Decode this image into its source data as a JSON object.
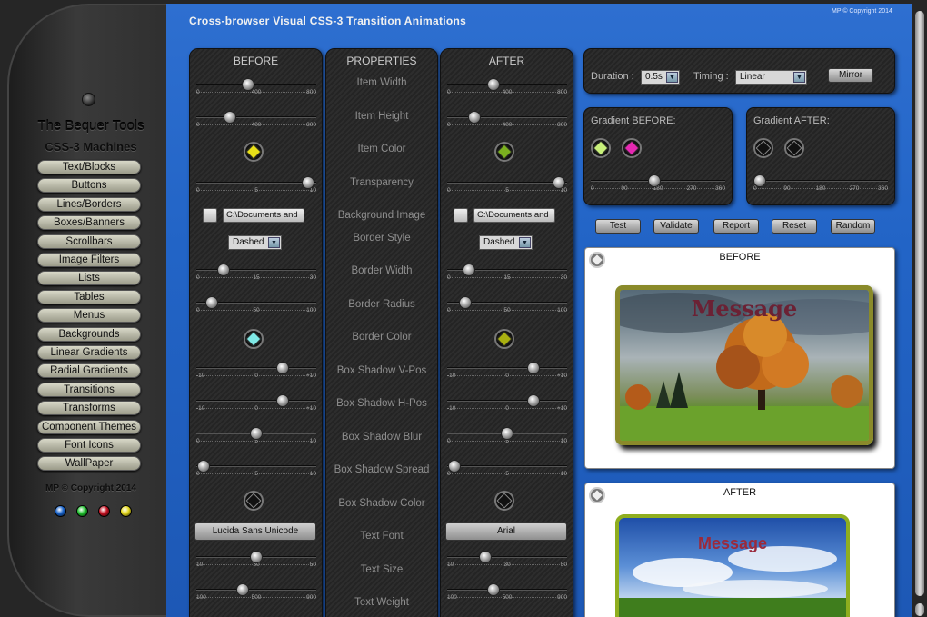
{
  "app": {
    "title": "Cross-browser Visual CSS-3 Transition Animations",
    "copyright": "MP © Copyright 2014"
  },
  "sidebar": {
    "title": "The Bequer Tools",
    "subtitle": "CSS-3 Machines",
    "items": [
      "Text/Blocks",
      "Buttons",
      "Lines/Borders",
      "Boxes/Banners",
      "Scrollbars",
      "Image Filters",
      "Lists",
      "Tables",
      "Menus",
      "Backgrounds",
      "Linear Gradients",
      "Radial Gradients",
      "Transitions",
      "Transforms",
      "Component Themes",
      "Font Icons",
      "WallPaper"
    ],
    "copyright": "MP © Copyright 2014",
    "dots": [
      "#1560c8",
      "#1bbf2a",
      "#c41020",
      "#e3d61a"
    ]
  },
  "columns": {
    "before": "BEFORE",
    "properties": "PROPERTIES",
    "after": "AFTER"
  },
  "properties": [
    "Item Width",
    "Item Height",
    "Item Color",
    "Transparency",
    "Background Image",
    "Border Style",
    "Border Width",
    "Border Radius",
    "Border Color",
    "Box Shadow V-Pos",
    "Box Shadow H-Pos",
    "Box Shadow Blur",
    "Box Shadow Spread",
    "Box Shadow Color",
    "Text Font",
    "Text Size",
    "Text Weight"
  ],
  "scales": {
    "width": [
      "0",
      "400",
      "800"
    ],
    "height": [
      "0",
      "400",
      "800"
    ],
    "transparency": [
      "0",
      "5",
      "10"
    ],
    "border_width": [
      "0",
      "15",
      "30"
    ],
    "border_radius": [
      "0",
      "50",
      "100"
    ],
    "shadow_v": [
      "-10",
      "0",
      "+10"
    ],
    "shadow_h": [
      "-10",
      "0",
      "+10"
    ],
    "shadow_blur": [
      "0",
      "5",
      "10"
    ],
    "shadow_spread": [
      "0",
      "5",
      "10"
    ],
    "text_size": [
      "10",
      "30",
      "50"
    ],
    "text_weight": [
      "100",
      "500",
      "900"
    ]
  },
  "before": {
    "width_value": 0.43,
    "height_value": 0.28,
    "item_color": "#e8e018",
    "transparency_value": 0.93,
    "bg_image_path": "C:\\Documents and",
    "border_style": "Dashed",
    "border_width_value": 0.23,
    "border_radius_value": 0.13,
    "border_color": "#7fe9e6",
    "shadow_v_value": 0.72,
    "shadow_h_value": 0.72,
    "shadow_blur_value": 0.5,
    "shadow_spread_value": 0.06,
    "shadow_color": "#111111",
    "text_font": "Lucida Sans Unicode",
    "text_size_value": 0.5,
    "text_weight_value": 0.39
  },
  "after": {
    "width_value": 0.39,
    "height_value": 0.23,
    "item_color": "#7bb01f",
    "transparency_value": 0.93,
    "bg_image_path": "C:\\Documents and",
    "border_style": "Dashed",
    "border_width_value": 0.18,
    "border_radius_value": 0.15,
    "border_color": "#a9b010",
    "shadow_v_value": 0.72,
    "shadow_h_value": 0.72,
    "shadow_blur_value": 0.5,
    "shadow_spread_value": 0.06,
    "shadow_color": "#111111",
    "text_font": "Arial",
    "text_size_value": 0.32,
    "text_weight_value": 0.39
  },
  "settings": {
    "duration_label": "Duration :",
    "duration_value": "0.5s",
    "timing_label": "Timing :",
    "timing_value": "Linear",
    "mirror_label": "Mirror"
  },
  "gradient_before": {
    "label": "Gradient BEFORE:",
    "colors": [
      "#c8f07a",
      "#e628b2"
    ],
    "scale": [
      "0",
      "90",
      "180",
      "270",
      "360"
    ],
    "value": 0.47
  },
  "gradient_after": {
    "label": "Gradient AFTER:",
    "colors": [
      "#111111",
      "#111111"
    ],
    "scale": [
      "0",
      "90",
      "180",
      "270",
      "360"
    ],
    "value": 0.05
  },
  "actions": [
    "Test",
    "Validate",
    "Report",
    "Reset",
    "Random"
  ],
  "preview_before": {
    "title": "BEFORE",
    "message": "Message"
  },
  "preview_after": {
    "title": "AFTER",
    "message": "Message"
  }
}
